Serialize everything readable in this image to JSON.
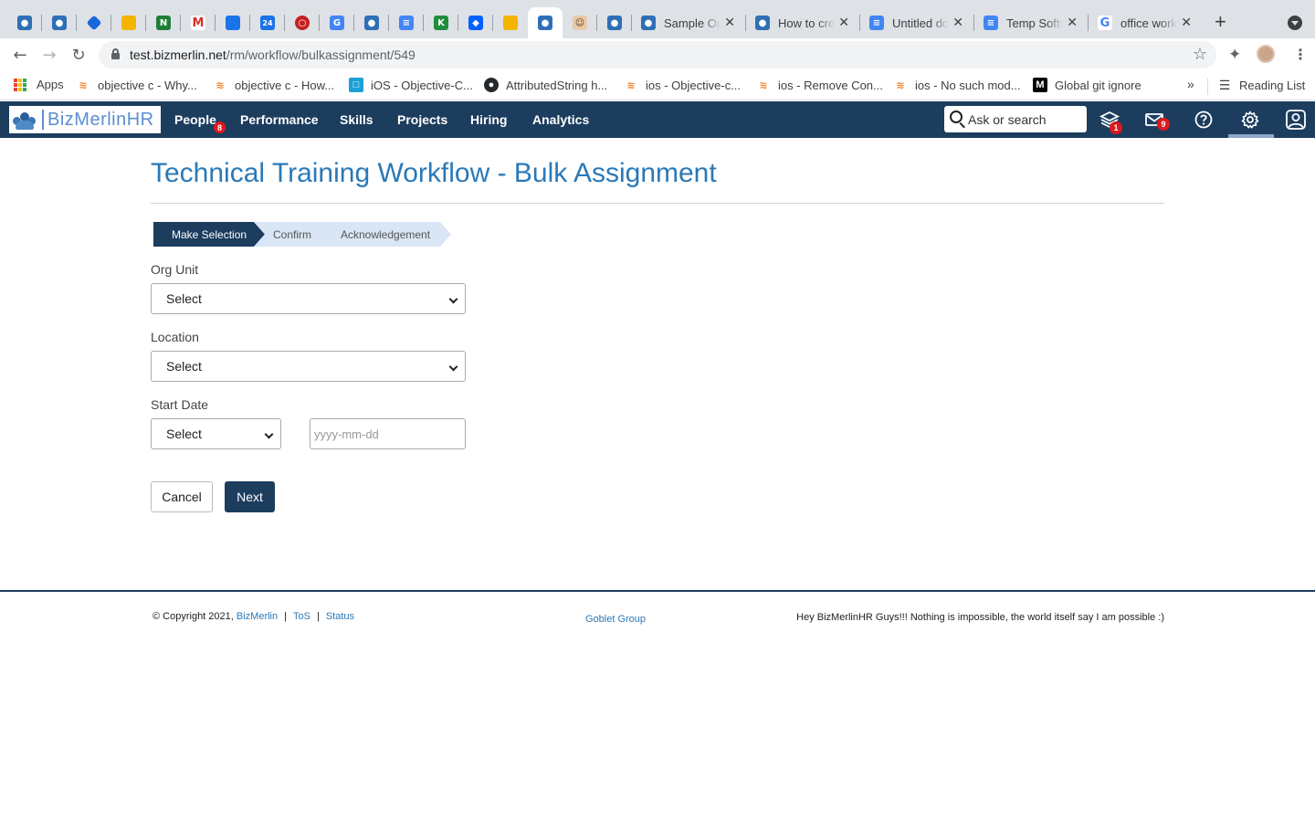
{
  "browser": {
    "tabs": [
      {
        "label": "Sample On"
      },
      {
        "label": "How to cre"
      },
      {
        "label": "Untitled do"
      },
      {
        "label": "Temp Softw"
      },
      {
        "label": "office work"
      }
    ],
    "url_host": "test.bizmerlin.net",
    "url_path": "/rm/workflow/bulkassignment/549",
    "bookmarks": [
      {
        "label": "Apps"
      },
      {
        "label": "objective c - Why..."
      },
      {
        "label": "objective c - How..."
      },
      {
        "label": "iOS - Objective-C..."
      },
      {
        "label": "AttributedString h..."
      },
      {
        "label": "ios - Objective-c..."
      },
      {
        "label": "ios - Remove Con..."
      },
      {
        "label": "ios - No such mod..."
      },
      {
        "label": "Global git ignore"
      }
    ],
    "reading_list": "Reading List"
  },
  "appnav": {
    "logo_text": "BizMerlinHR",
    "links": [
      {
        "label": "People",
        "badge": "8"
      },
      {
        "label": "Performance"
      },
      {
        "label": "Skills"
      },
      {
        "label": "Projects"
      },
      {
        "label": "Hiring"
      },
      {
        "label": "Analytics"
      }
    ],
    "search_placeholder": "Ask or search",
    "layers_badge": "1",
    "mail_badge": "9",
    "accent_color": "#1c3d5e"
  },
  "main": {
    "title": "Technical Training Workflow - Bulk Assignment",
    "steps": [
      {
        "label": "Make Selection",
        "active": true
      },
      {
        "label": "Confirm",
        "active": false
      },
      {
        "label": "Acknowledgement",
        "active": false
      }
    ],
    "org_unit": {
      "label": "Org Unit",
      "value": "Select"
    },
    "location": {
      "label": "Location",
      "value": "Select"
    },
    "start_date": {
      "label": "Start Date",
      "value": "Select",
      "date_placeholder": "yyyy-mm-dd"
    },
    "cancel_label": "Cancel",
    "next_label": "Next"
  },
  "footer": {
    "copyright": "© Copyright 2021,",
    "company_link": "BizMerlin",
    "tos_link": "ToS",
    "status_link": "Status",
    "center_link": "Goblet Group",
    "tagline": "Hey BizMerlinHR Guys!!! Nothing is impossible, the world itself say I am possible :)"
  }
}
